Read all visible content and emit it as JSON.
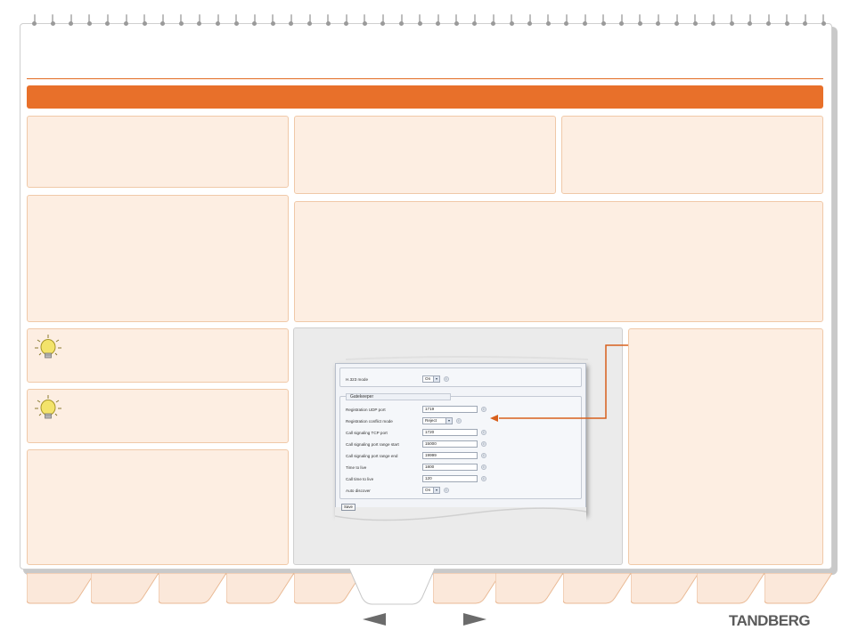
{
  "brand": {
    "name": "TANDBERG"
  },
  "colors": {
    "accent": "#e8702a",
    "panel_bg": "#fdeee2",
    "panel_border": "#f0c9a8",
    "tab_fill": "#fbe8da",
    "arrow": "#6b6b6b"
  },
  "tips": [
    {
      "icon": "lightbulb-icon"
    },
    {
      "icon": "lightbulb-icon"
    }
  ],
  "nav": {
    "prev_icon": "arrow-left-icon",
    "next_icon": "arrow-right-icon"
  },
  "settings_screenshot": {
    "h323_mode": {
      "label": "H.323 mode",
      "value": "On"
    },
    "gatekeeper": {
      "legend": "Gatekeeper",
      "fields": [
        {
          "label": "Registration UDP port",
          "value": "1719",
          "kind": "input"
        },
        {
          "label": "Registration conflict mode",
          "value": "Reject",
          "kind": "select"
        },
        {
          "label": "Call signaling TCP port",
          "value": "1720",
          "kind": "input"
        },
        {
          "label": "Call signaling port range start",
          "value": "15000",
          "kind": "input"
        },
        {
          "label": "Call signaling port range end",
          "value": "19999",
          "kind": "input"
        },
        {
          "label": "Time to live",
          "value": "1800",
          "kind": "input"
        },
        {
          "label": "Call time to live",
          "value": "120",
          "kind": "input"
        },
        {
          "label": "Auto discover",
          "value": "On",
          "kind": "select"
        }
      ]
    },
    "save_label": "Save"
  }
}
